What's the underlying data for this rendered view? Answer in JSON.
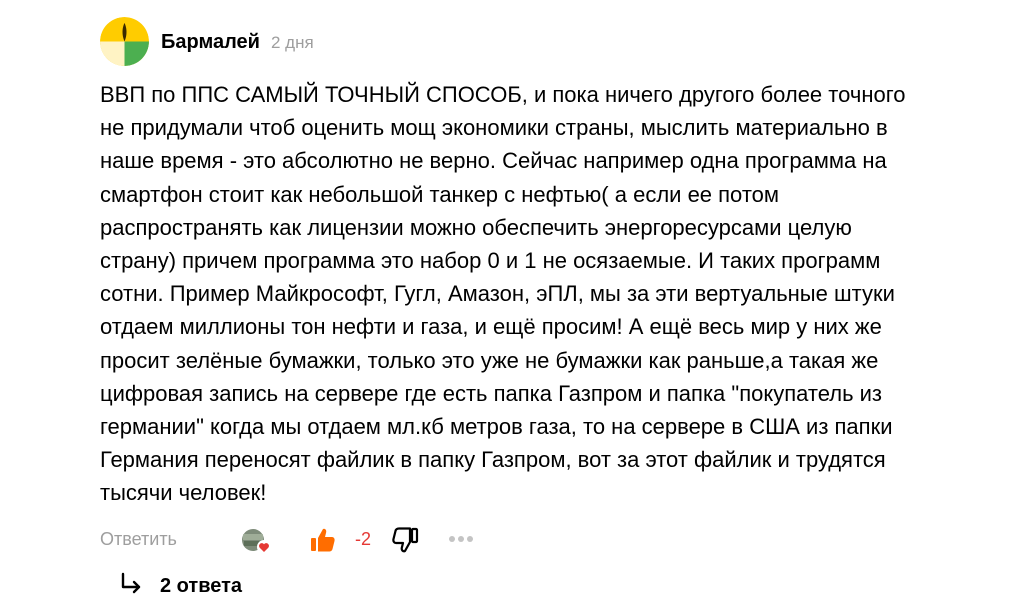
{
  "comment": {
    "author": "Бармалей",
    "time": "2 дня",
    "text": "ВВП по ППС САМЫЙ ТОЧНЫЙ СПОСОБ, и пока ничего другого более точного\nне придумали чтоб оценить мощ экономики страны, мыслить материально в\nнаше время - это абсолютно не верно. Сейчас например одна программа на\nсмартфон стоит как небольшой танкер с нефтью( а если ее потом\nраспространять как лицензии можно обеспечить энергоресурсами целую\nстрану) причем программа это набор 0 и 1 не осязаемые. И таких программ\nсотни. Пример Майкрософт, Гугл, Амазон, эПЛ, мы за эти вертуальные штуки\nотдаем миллионы тон нефти и газа, и ещё просим! А ещё весь мир у них же\nпросит зелёные бумажки, только это уже не бумажки как раньше,а такая же\nцифровая запись на сервере где есть папка Газпром и папка \"покупатель из\nгермании\" когда мы отдаем мл.кб метров газа, то на сервере в США из папки\nГермания переносят файлик в папку Газпром, вот за этот файлик и трудятся\nтысячи человек!",
    "avatar_icon": "yellow-green-avatar"
  },
  "actions": {
    "reply_label": "Ответить",
    "reactor_icon": "reactor-avatar-heart-icon",
    "like_icon": "thumb-up-icon",
    "score": "-2",
    "dislike_icon": "thumb-down-icon",
    "more_icon": "more-dots-icon"
  },
  "replies": {
    "label": "2 ответа",
    "icon": "reply-arrow-icon"
  },
  "colors": {
    "muted": "#9e9e9e",
    "score": "#e53935",
    "like": "#ff6d00",
    "avatar_yellow": "#ffcc00",
    "avatar_green": "#4caf50",
    "avatar_cream": "#fff3c4"
  }
}
